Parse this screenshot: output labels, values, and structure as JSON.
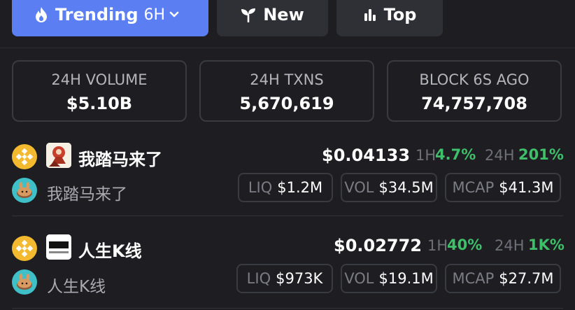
{
  "tabs": {
    "trending": {
      "label": "Trending",
      "period": "6H",
      "icon": "flame-icon"
    },
    "new": {
      "label": "New",
      "icon": "sprout-icon"
    },
    "top": {
      "label": "Top",
      "icon": "bar-chart-icon"
    }
  },
  "stats": [
    {
      "label": "24H VOLUME",
      "value": "$5.10B"
    },
    {
      "label": "24H TXNS",
      "value": "5,670,619"
    },
    {
      "label": "BLOCK 6S AGO",
      "value": "74,757,708"
    }
  ],
  "tokens": [
    {
      "name": "我踏马来了",
      "subtitle": "我踏马来了",
      "chain_icon": "bnb-icon",
      "dex_icon": "pancakeswap-icon",
      "price": "$0.04133",
      "h1_label": "1H",
      "h1_value": "4.7%",
      "h24_label": "24H",
      "h24_value": "201%",
      "liq_label": "LIQ",
      "liq_value": "$1.2M",
      "vol_label": "VOL",
      "vol_value": "$34.5M",
      "mcap_label": "MCAP",
      "mcap_value": "$41.3M"
    },
    {
      "name": "人生K线",
      "subtitle": "人生K线",
      "chain_icon": "bnb-icon",
      "dex_icon": "pancakeswap-icon",
      "price": "$0.02772",
      "h1_label": "1H",
      "h1_value": "40%",
      "h24_label": "24H",
      "h24_value": "1K%",
      "liq_label": "LIQ",
      "liq_value": "$973K",
      "vol_label": "VOL",
      "vol_value": "$19.1M",
      "mcap_label": "MCAP",
      "mcap_value": "$27.7M"
    }
  ],
  "colors": {
    "accent": "#5b7ff2",
    "positive": "#3fbf6a",
    "bnb": "#f3ba2f",
    "pancake": "#3fc0c9"
  }
}
